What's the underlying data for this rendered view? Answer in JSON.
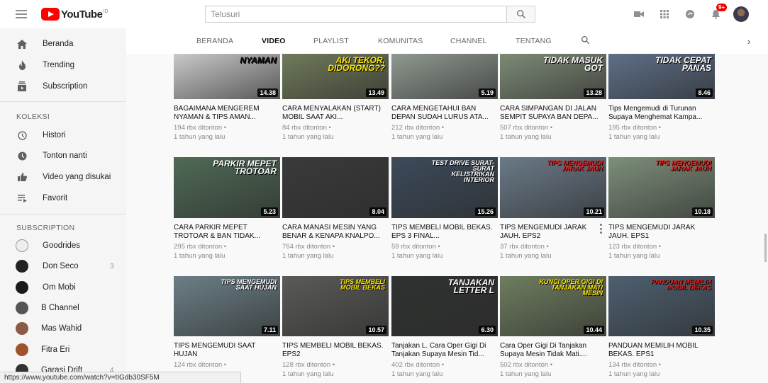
{
  "header": {
    "logo_text": "YouTube",
    "logo_region": "ID",
    "search_placeholder": "Telusuri",
    "notification_count": "9+"
  },
  "sidebar": {
    "main": [
      {
        "label": "Beranda",
        "icon": "home-icon"
      },
      {
        "label": "Trending",
        "icon": "flame-icon"
      },
      {
        "label": "Subscription",
        "icon": "subscriptions-icon"
      }
    ],
    "koleksi_heading": "KOLEKSI",
    "koleksi": [
      {
        "label": "Histori",
        "icon": "history-icon"
      },
      {
        "label": "Tonton nanti",
        "icon": "clock-icon"
      },
      {
        "label": "Video yang disukai",
        "icon": "thumbs-up-icon"
      },
      {
        "label": "Favorit",
        "icon": "playlist-icon"
      }
    ],
    "subscription_heading": "SUBSCRIPTION",
    "subscriptions": [
      {
        "label": "Goodrides",
        "count": "",
        "color": "#e8e8e8"
      },
      {
        "label": "Don Seco",
        "count": "3",
        "color": "#222222"
      },
      {
        "label": "Om Mobi",
        "count": "",
        "color": "#1b1b1b"
      },
      {
        "label": "B Channel",
        "count": "",
        "color": "#555555"
      },
      {
        "label": "Mas Wahid",
        "count": "",
        "color": "#8a5a44"
      },
      {
        "label": "Fitra Eri",
        "count": "",
        "color": "#a0522d"
      },
      {
        "label": "Garasi Drift",
        "count": "4",
        "color": "#333333"
      }
    ]
  },
  "tabs": [
    "BERANDA",
    "VIDEO",
    "PLAYLIST",
    "KOMUNITAS",
    "CHANNEL",
    "TENTANG"
  ],
  "active_tab": "VIDEO",
  "videos": [
    {
      "title": "BAGAIMANA MENGEREM NYAMAN & TIPS AMAN...",
      "views": "194 rbx ditonton •",
      "age": "1 tahun yang lalu",
      "duration": "14.38",
      "overlay": "NYAMAN",
      "bg": "#c9c9c9",
      "overlay_color": "#111"
    },
    {
      "title": "CARA MENYALAKAN (START) MOBIL SAAT AKI...",
      "views": "84 rbx ditonton •",
      "age": "1 tahun yang lalu",
      "duration": "13.49",
      "overlay": "AKI TEKOR, DIDORONG??",
      "bg": "#6f7a5a",
      "overlay_color": "#ffe600"
    },
    {
      "title": "CARA MENGETAHUI BAN DEPAN SUDAH LURUS ATA...",
      "views": "212 rbx ditonton •",
      "age": "1 tahun yang lalu",
      "duration": "5.19",
      "overlay": "",
      "bg": "#8f9990",
      "overlay_color": "#fff"
    },
    {
      "title": "CARA SIMPANGAN DI JALAN SEMPIT SUPAYA BAN DEPA...",
      "views": "507 rbx ditonton •",
      "age": "1 tahun yang lalu",
      "duration": "13.28",
      "overlay": "TIDAK MASUK GOT",
      "bg": "#7d8a76",
      "overlay_color": "#fff"
    },
    {
      "title": "Tips Mengemudi di Turunan Supaya Menghemat Kampa...",
      "views": "195 rbx ditonton •",
      "age": "1 tahun yang lalu",
      "duration": "8.46",
      "overlay": "TIDAK CEPAT PANAS",
      "bg": "#5e6f88",
      "overlay_color": "#fff"
    },
    {
      "title": "CARA PARKIR MEPET TROTOAR & BAN TIDAK...",
      "views": "295 rbx ditonton •",
      "age": "1 tahun yang lalu",
      "duration": "5.23",
      "overlay": "PARKIR MEPET TROTOAR",
      "bg": "#4f6a55",
      "overlay_color": "#fff"
    },
    {
      "title": "CARA MANASI MESIN YANG BENAR & KENAPA KNALPO...",
      "views": "764 rbx ditonton •",
      "age": "1 tahun yang lalu",
      "duration": "8.04",
      "overlay": "",
      "bg": "#3a3a3a",
      "overlay_color": "#fff"
    },
    {
      "title": "TIPS MEMBELI MOBIL BEKAS. Eps 3 FINAL...",
      "views": "59 rbx ditonton •",
      "age": "1 tahun yang lalu",
      "duration": "15.26",
      "overlay": "Test Drive Surat-surat Kelistrikan Interior",
      "bg": "#3c4a5a",
      "overlay_color": "#fff"
    },
    {
      "title": "TIPS MENGEMUDI JARAK JAUH. Eps2",
      "views": "37 rbx ditonton •",
      "age": "1 tahun yang lalu",
      "duration": "10.21",
      "overlay": "TIPS MENGEMUDI JARAK JAUH",
      "bg": "#6a7a88",
      "overlay_color": "#e02020"
    },
    {
      "title": "TIPS MENGEMUDI JARAK JAUH. Eps1",
      "views": "123 rbx ditonton •",
      "age": "1 tahun yang lalu",
      "duration": "10.18",
      "overlay": "TIPS MENGEMUDI JARAK JAUH",
      "bg": "#7d8f7a",
      "overlay_color": "#e02020"
    },
    {
      "title": "TIPS MENGEMUDI SAAT HUJAN",
      "views": "124 rbx ditonton •",
      "age": "",
      "duration": "7.11",
      "overlay": "TIPS MENGEMUDI SAAT HUJAN",
      "bg": "#6b7f86",
      "overlay_color": "#fff"
    },
    {
      "title": "TIPS MEMBELI MOBIL BEKAS. Eps2",
      "views": "128 rbx ditonton •",
      "age": "1 tahun yang lalu",
      "duration": "10.57",
      "overlay": "TIPS MEMBELI MOBIL BEKAS",
      "bg": "#5a5a58",
      "overlay_color": "#ffe600"
    },
    {
      "title": "Tanjakan L. Cara Oper Gigi Di Tanjakan Supaya Mesin Tid...",
      "views": "402 rbx ditonton •",
      "age": "1 tahun yang lalu",
      "duration": "6.30",
      "overlay": "TANJAKAN LETTER L",
      "bg": "#2f3230",
      "overlay_color": "#fff"
    },
    {
      "title": "Cara Oper Gigi Di Tanjakan Supaya Mesin Tidak Mati....",
      "views": "502 rbx ditonton •",
      "age": "1 tahun yang lalu",
      "duration": "10.44",
      "overlay": "KUNCI OPER GIGI DI TANJAKAN MATI MESIN",
      "bg": "#6e7d5f",
      "overlay_color": "#ffe600"
    },
    {
      "title": "PANDUAN MEMILIH MOBIL BEKAS. Eps1",
      "views": "134 rbx ditonton •",
      "age": "1 tahun yang lalu",
      "duration": "10.35",
      "overlay": "PANDUAN MEMILIH MOBIL BEKAS",
      "bg": "#4d6070",
      "overlay_color": "#e02020"
    }
  ],
  "status_url": "https://www.youtube.com/watch?v=tIGdb30SF5M"
}
